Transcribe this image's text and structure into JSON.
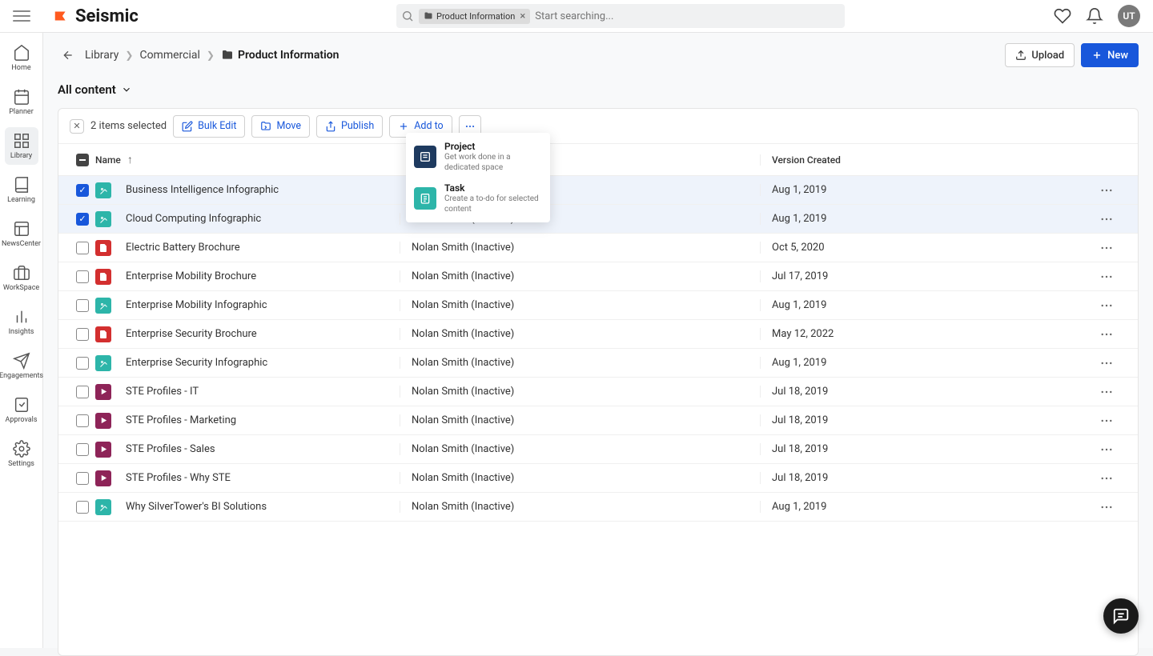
{
  "brand": "Seismic",
  "search": {
    "chip": "Product Information",
    "placeholder": "Start searching..."
  },
  "avatar": "UT",
  "sidebar": [
    {
      "label": "Home"
    },
    {
      "label": "Planner"
    },
    {
      "label": "Library"
    },
    {
      "label": "Learning"
    },
    {
      "label": "NewsCenter"
    },
    {
      "label": "WorkSpace"
    },
    {
      "label": "Insights"
    },
    {
      "label": "Engagements"
    },
    {
      "label": "Approvals"
    },
    {
      "label": "Settings"
    }
  ],
  "breadcrumb": {
    "l1": "Library",
    "l2": "Commercial",
    "current": "Product Information"
  },
  "buttons": {
    "upload": "Upload",
    "new": "New"
  },
  "subhead": "All content",
  "toolbar": {
    "selected": "2 items selected",
    "bulk_edit": "Bulk Edit",
    "move": "Move",
    "publish": "Publish",
    "add_to": "Add to"
  },
  "dropdown": {
    "project": {
      "title": "Project",
      "sub": "Get work done in a dedicated space"
    },
    "task": {
      "title": "Task",
      "sub": "Create a to-do for selected content"
    }
  },
  "columns": {
    "name": "Name",
    "owner": "",
    "date": "Version Created"
  },
  "rows": [
    {
      "checked": true,
      "icon": "img",
      "name": "Business Intelligence Infographic",
      "owner": "",
      "date": "Aug 1, 2019"
    },
    {
      "checked": true,
      "icon": "img",
      "name": "Cloud Computing Infographic",
      "owner": "Nolan Smith (Inactive)",
      "date": "Aug 1, 2019"
    },
    {
      "checked": false,
      "icon": "pdf",
      "name": "Electric Battery Brochure",
      "owner": "Nolan Smith (Inactive)",
      "date": "Oct 5, 2020"
    },
    {
      "checked": false,
      "icon": "pdf",
      "name": "Enterprise Mobility Brochure",
      "owner": "Nolan Smith (Inactive)",
      "date": "Jul 17, 2019"
    },
    {
      "checked": false,
      "icon": "img",
      "name": "Enterprise Mobility Infographic",
      "owner": "Nolan Smith (Inactive)",
      "date": "Aug 1, 2019"
    },
    {
      "checked": false,
      "icon": "pdf",
      "name": "Enterprise Security Brochure",
      "owner": "Nolan Smith (Inactive)",
      "date": "May 12, 2022"
    },
    {
      "checked": false,
      "icon": "img",
      "name": "Enterprise Security Infographic",
      "owner": "Nolan Smith (Inactive)",
      "date": "Aug 1, 2019"
    },
    {
      "checked": false,
      "icon": "vid",
      "name": "STE Profiles - IT",
      "owner": "Nolan Smith (Inactive)",
      "date": "Jul 18, 2019"
    },
    {
      "checked": false,
      "icon": "vid",
      "name": "STE Profiles - Marketing",
      "owner": "Nolan Smith (Inactive)",
      "date": "Jul 18, 2019"
    },
    {
      "checked": false,
      "icon": "vid",
      "name": "STE Profiles - Sales",
      "owner": "Nolan Smith (Inactive)",
      "date": "Jul 18, 2019"
    },
    {
      "checked": false,
      "icon": "vid",
      "name": "STE Profiles - Why STE",
      "owner": "Nolan Smith (Inactive)",
      "date": "Jul 18, 2019"
    },
    {
      "checked": false,
      "icon": "img",
      "name": "Why SilverTower's BI Solutions",
      "owner": "Nolan Smith (Inactive)",
      "date": "Aug 1, 2019"
    }
  ]
}
